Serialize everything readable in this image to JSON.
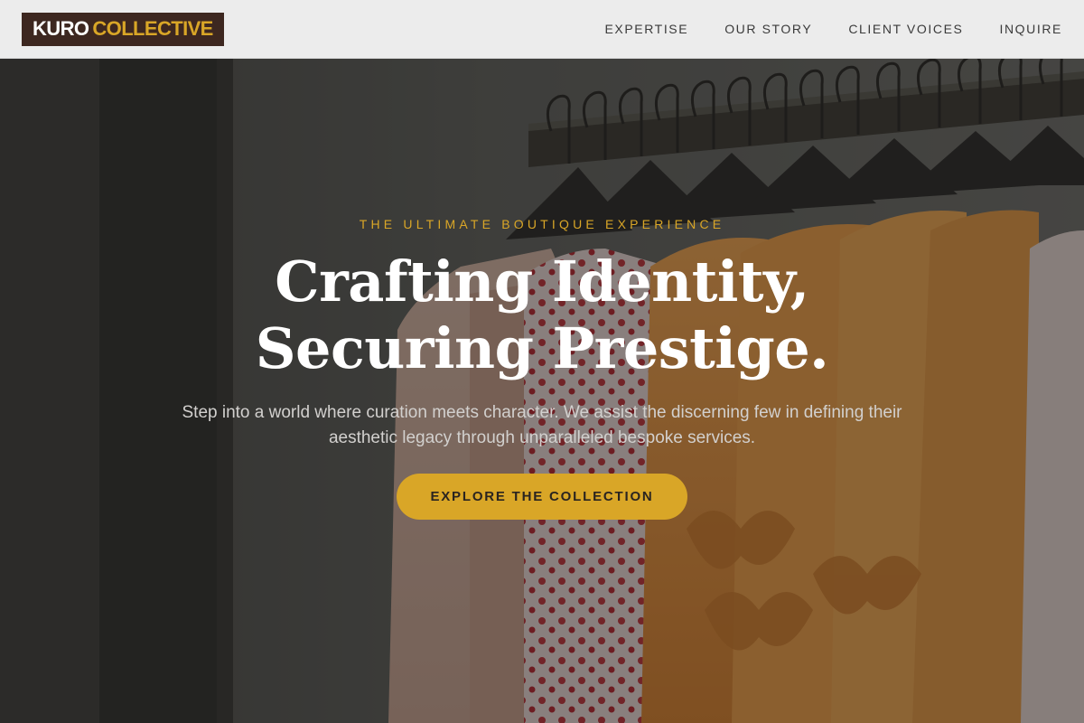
{
  "brand": {
    "logo_word_1": "KURO",
    "logo_word_2": "COLLECTIVE",
    "logo_bg_color": "#3d2720",
    "accent_color": "#d9a627"
  },
  "nav": {
    "items": [
      {
        "label": "EXPERTISE"
      },
      {
        "label": "OUR STORY"
      },
      {
        "label": "CLIENT VOICES"
      },
      {
        "label": "INQUIRE"
      }
    ]
  },
  "hero": {
    "eyebrow": "THE ULTIMATE BOUTIQUE EXPERIENCE",
    "headline_line_1": "Crafting Identity,",
    "headline_line_2": "Securing Prestige.",
    "lede": "Step into a world where curation meets character. We assist the discerning few in defining their aesthetic legacy through unparalleled bespoke services.",
    "cta_label": "EXPLORE THE COLLECTION",
    "background_image": "clothing-rack-photo"
  }
}
